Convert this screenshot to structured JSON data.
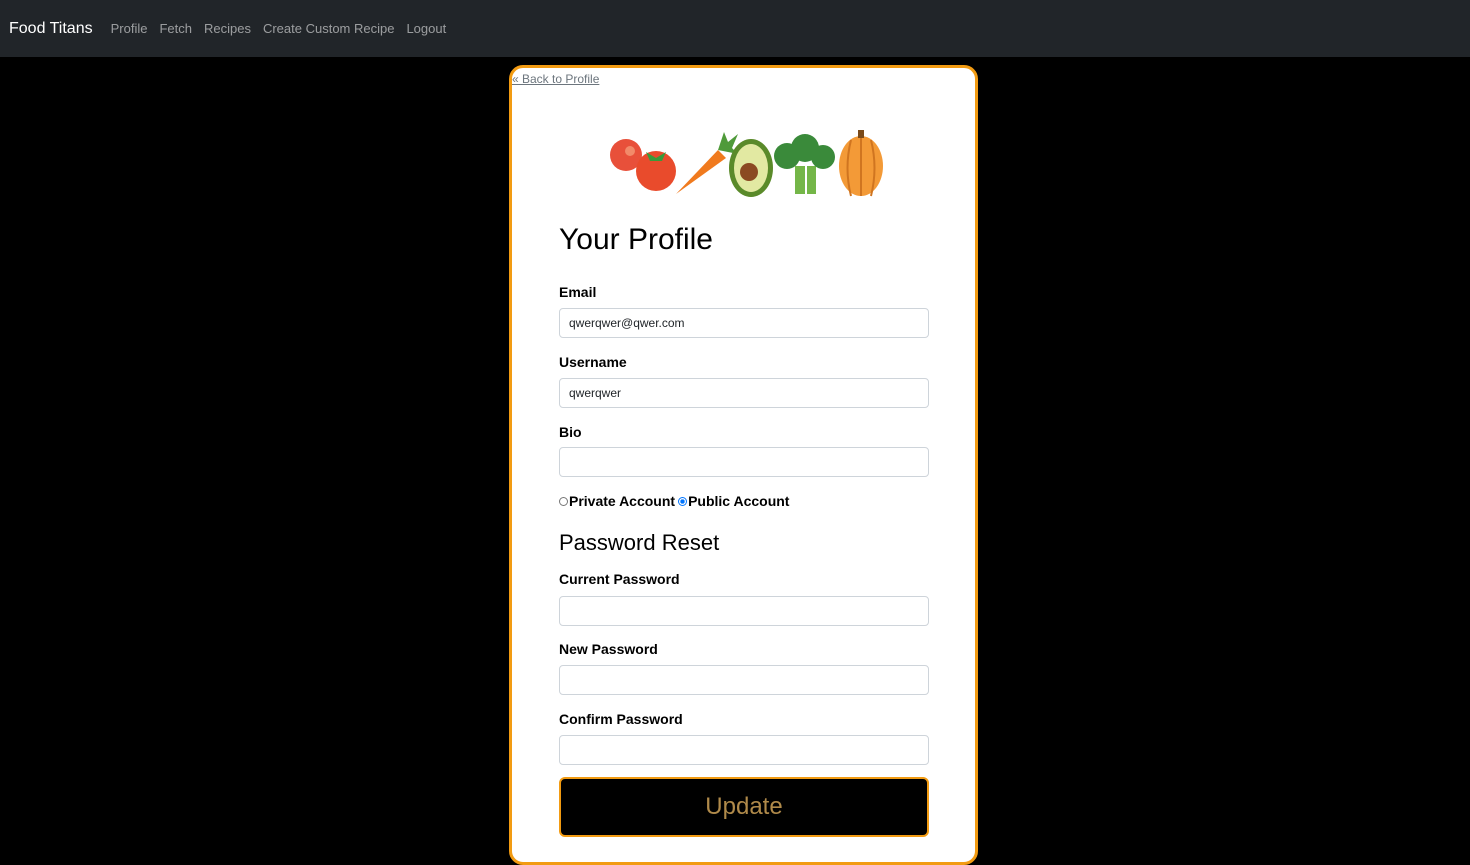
{
  "nav": {
    "brand": "Food Titans",
    "links": [
      "Profile",
      "Fetch",
      "Recipes",
      "Create Custom Recipe",
      "Logout"
    ]
  },
  "card": {
    "back_link": "« Back to Profile",
    "title": "Your Profile",
    "email_label": "Email",
    "email_value": "qwerqwer@qwer.com",
    "username_label": "Username",
    "username_value": "qwerqwer",
    "bio_label": "Bio",
    "bio_value": "",
    "private_label": "Private Account",
    "public_label": "Public Account",
    "password_title": "Password Reset",
    "current_password_label": "Current Password",
    "new_password_label": "New Password",
    "confirm_password_label": "Confirm Password",
    "update_button": "Update"
  },
  "colors": {
    "accent": "#f29b12",
    "navbar": "#212529",
    "background": "#000000"
  },
  "icons": [
    "tomato-icon",
    "carrot-icon",
    "avocado-icon",
    "broccoli-icon",
    "squash-icon"
  ]
}
